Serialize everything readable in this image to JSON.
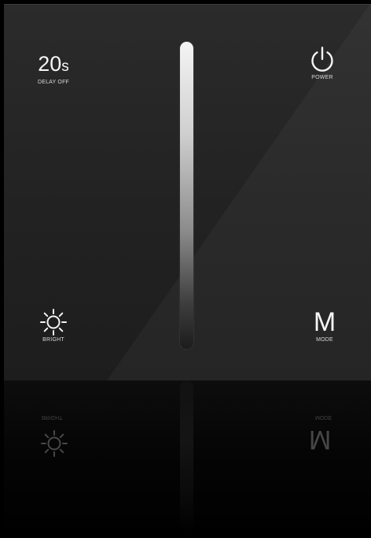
{
  "delay": {
    "value": "20",
    "unit": "s",
    "label": "DELAY OFF"
  },
  "power": {
    "icon": "power-icon",
    "label": "POWER"
  },
  "bright": {
    "icon": "sun-icon",
    "label": "BRIGHT"
  },
  "mode": {
    "letter": "M",
    "label": "MODE"
  },
  "slider": {
    "icon": "vertical-slider"
  },
  "colors": {
    "background": "#000000",
    "panel": "#252525",
    "foreground": "#f2f2f2"
  }
}
